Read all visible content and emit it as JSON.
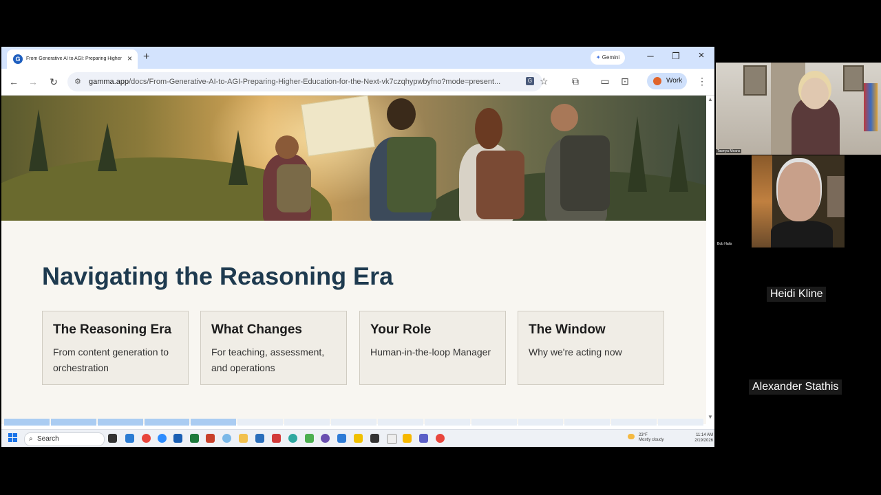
{
  "browser": {
    "tab": {
      "title": "From Generative AI to AGI: Preparing Higher Ed",
      "favicon_letter": "G"
    },
    "gemini_label": "Gemini",
    "url": {
      "host": "gamma.app",
      "path": "/docs/From-Generative-AI-to-AGI-Preparing-Higher-Education-for-the-Next-vk7czqhypwbyfno?mode=present..."
    },
    "profile_label": "Work",
    "omnibox_badge": "G"
  },
  "slide": {
    "title": "Navigating the Reasoning Era",
    "cards": [
      {
        "title": "The Reasoning Era",
        "desc": "From content generation to orchestration"
      },
      {
        "title": "What Changes",
        "desc": "For teaching, assessment, and operations"
      },
      {
        "title": "Your Role",
        "desc": "Human-in-the-loop Manager"
      },
      {
        "title": "The Window",
        "desc": "Why we're acting now"
      }
    ],
    "progress": {
      "total_segments": 15,
      "completed_segments": 5
    }
  },
  "taskbar": {
    "search_label": "Search",
    "weather": {
      "temp": "23°F",
      "condition": "Mostly cloudy"
    },
    "clock": {
      "time": "11:14 AM",
      "date": "2/19/2026"
    }
  },
  "meeting": {
    "participants": [
      {
        "name": "Tawnya Means"
      },
      {
        "name": "Bob Hails"
      },
      {
        "name": "Heidi Kline"
      },
      {
        "name": "Alexander Stathis"
      }
    ]
  },
  "icons": {
    "close": "×",
    "plus": "+",
    "minimize": "─",
    "restore": "❐",
    "back": "←",
    "forward": "→",
    "reload": "↻",
    "star": "☆",
    "extensions": "⧉",
    "menu": "⋮",
    "search": "⌕"
  }
}
